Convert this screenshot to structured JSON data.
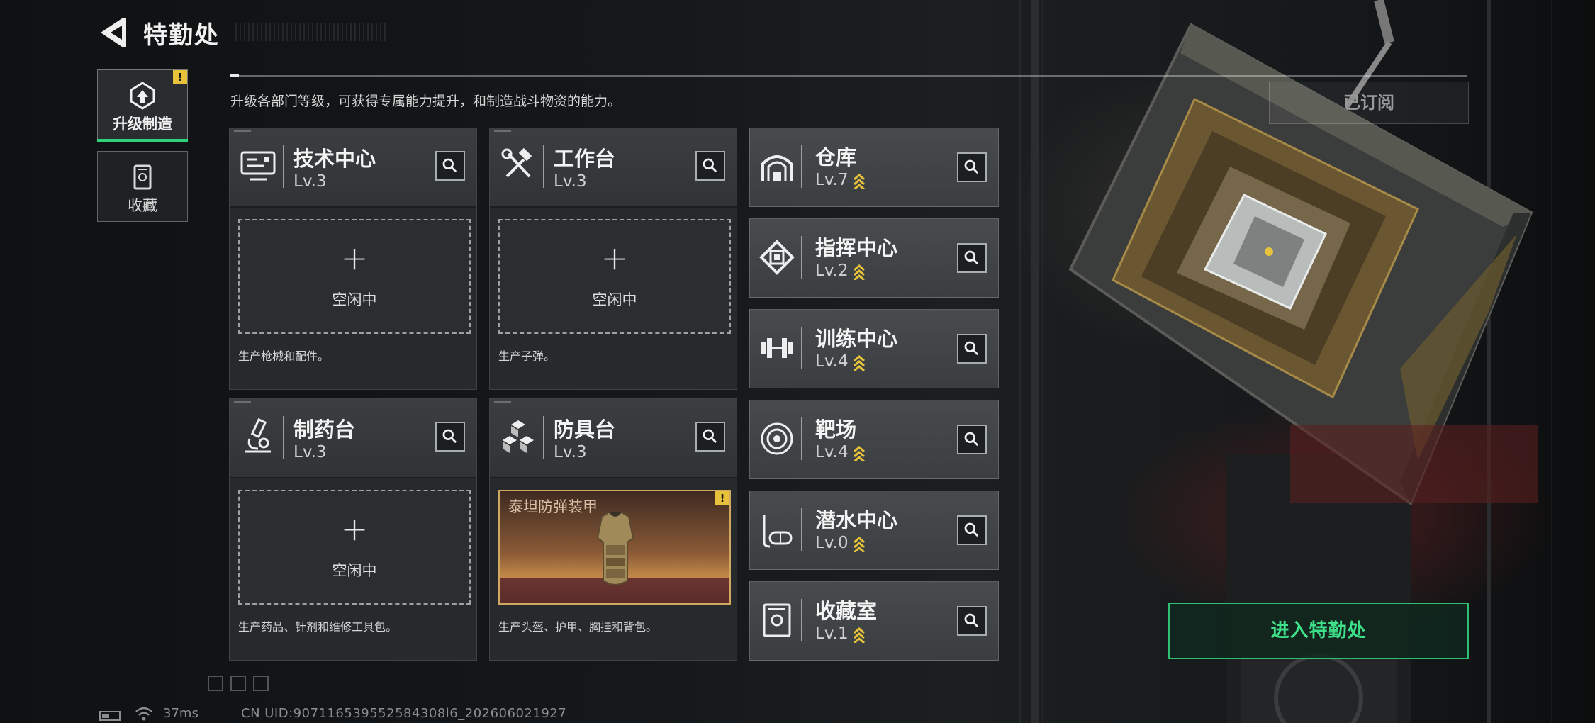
{
  "header": {
    "title": "特勤处",
    "subtitle": "升级各部门等级，可获得专属能力提升，和制造战斗物资的能力。"
  },
  "nav": {
    "tabs": [
      {
        "label": "升级制造",
        "icon": "upgrade-icon",
        "active": true,
        "alert": "!"
      },
      {
        "label": "收藏",
        "icon": "collection-icon",
        "active": false
      }
    ]
  },
  "facilities": [
    {
      "name": "技术中心",
      "level": "Lv.3",
      "icon": "monitor-icon",
      "slot_status": "空闲中",
      "description": "生产枪械和配件。"
    },
    {
      "name": "工作台",
      "level": "Lv.3",
      "icon": "tools-icon",
      "slot_status": "空闲中",
      "description": "生产子弹。"
    },
    {
      "name": "制药台",
      "level": "Lv.3",
      "icon": "microscope-icon",
      "slot_status": "空闲中",
      "description": "生产药品、针剂和维修工具包。"
    },
    {
      "name": "防具台",
      "level": "Lv.3",
      "icon": "cubes-icon",
      "production_item": "泰坦防弹装甲",
      "production_alert": "!",
      "description": "生产头盔、护甲、胸挂和背包。"
    }
  ],
  "side_facilities": [
    {
      "name": "仓库",
      "level": "Lv.7",
      "icon": "warehouse-icon"
    },
    {
      "name": "指挥中心",
      "level": "Lv.2",
      "icon": "chip-icon"
    },
    {
      "name": "训练中心",
      "level": "Lv.4",
      "icon": "dumbbell-icon"
    },
    {
      "name": "靶场",
      "level": "Lv.4",
      "icon": "target-icon"
    },
    {
      "name": "潜水中心",
      "level": "Lv.0",
      "icon": "diving-mask-icon"
    },
    {
      "name": "收藏室",
      "level": "Lv.1",
      "icon": "vault-icon"
    }
  ],
  "right_panel": {
    "subscribed_label": "已订阅",
    "enter_label": "进入特勤处"
  },
  "status_bar": {
    "ping": "37ms",
    "uid": "CN UID:907116539552584308l6_202606021927"
  },
  "colors": {
    "accent_green": "#2fd27a",
    "level_chevron": "#e8c23a",
    "alert_yellow": "#e8c23a"
  }
}
